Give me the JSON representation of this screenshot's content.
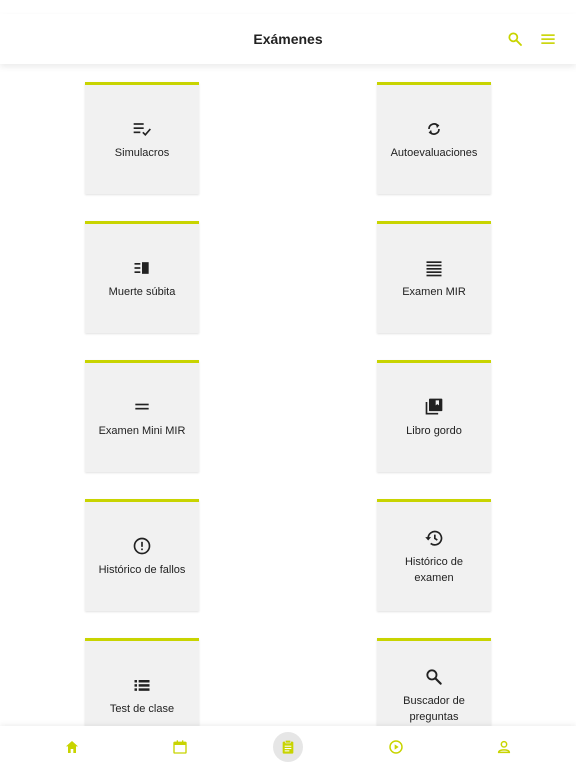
{
  "header": {
    "title": "Exámenes"
  },
  "cards": [
    {
      "label": "Simulacros",
      "icon": "checklist-icon"
    },
    {
      "label": "Autoevaluaciones",
      "icon": "sync-icon"
    },
    {
      "label": "Muerte súbita",
      "icon": "split-list-icon"
    },
    {
      "label": "Examen MIR",
      "icon": "justify-lines-icon"
    },
    {
      "label": "Examen Mini MIR",
      "icon": "equals-icon"
    },
    {
      "label": "Libro gordo",
      "icon": "library-icon"
    },
    {
      "label": "Histórico de fallos",
      "icon": "exclamation-circle-icon"
    },
    {
      "label": "Histórico de examen",
      "icon": "history-icon"
    },
    {
      "label": "Test de clase",
      "icon": "list-icon"
    },
    {
      "label": "Buscador de preguntas",
      "icon": "search-icon"
    }
  ],
  "nav": [
    {
      "icon": "home-icon"
    },
    {
      "icon": "calendar-icon"
    },
    {
      "icon": "clipboard-icon",
      "active": true
    },
    {
      "icon": "play-circle-icon"
    },
    {
      "icon": "person-icon"
    }
  ],
  "colors": {
    "accent": "#c8d400",
    "card_bg": "#f1f1f1",
    "text": "#222222"
  }
}
